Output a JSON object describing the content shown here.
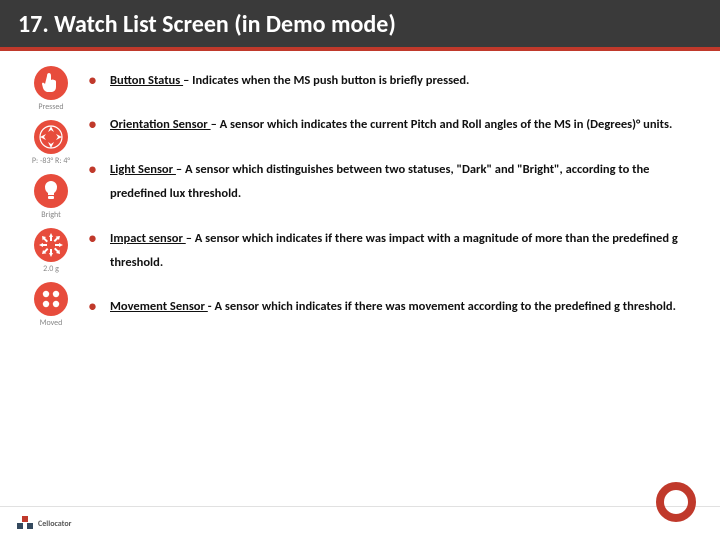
{
  "header": {
    "title": "17. Watch List Screen (in Demo mode)"
  },
  "sensors": [
    {
      "label": "Pressed"
    },
    {
      "label": "P: -83° R: 4°"
    },
    {
      "label": "Bright"
    },
    {
      "label": "2.0 g"
    },
    {
      "label": "Moved"
    }
  ],
  "bullets": [
    {
      "title": "Button Status ",
      "rest": "– Indicates when the MS push button is briefly pressed."
    },
    {
      "title": "Orientation Sensor ",
      "rest": "– A sensor which indicates the current Pitch and Roll angles of the MS in (Degrees)° units."
    },
    {
      "title": "Light Sensor ",
      "rest": "– A sensor which distinguishes between two statuses, \"Dark\" and \"Bright\", according to the predefined lux threshold."
    },
    {
      "title": "Impact sensor ",
      "rest": "– A sensor which indicates if there was impact with a magnitude of more than the predefined g threshold."
    },
    {
      "title": "Movement Sensor ",
      "rest": "- A sensor which indicates if there was movement according to the predefined g threshold."
    }
  ],
  "footer": {
    "logo_text": "Cellocator"
  }
}
